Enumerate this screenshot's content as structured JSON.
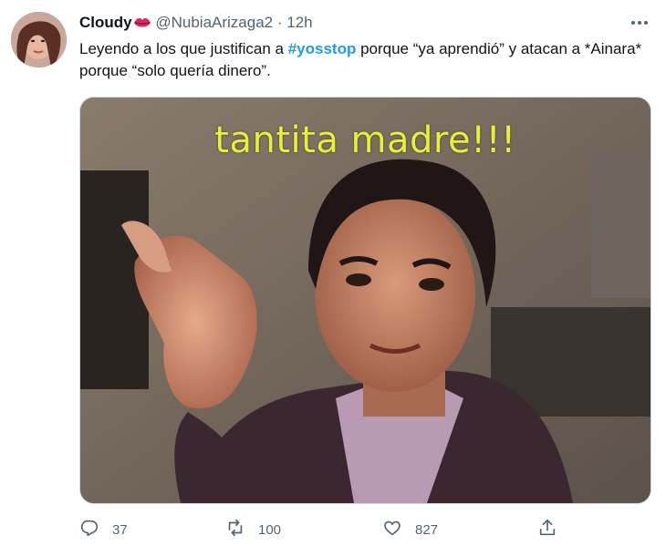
{
  "tweet": {
    "author": {
      "display_name": "Cloudy",
      "handle": "@NubiaArizaga2",
      "separator": "·",
      "time": "12h"
    },
    "text": {
      "part1": "Leyendo a los que justifican a ",
      "hashtag": "#yosstop",
      "part2": " porque “ya aprendió” y atacan a *Ainara* porque “solo quería dinero”."
    },
    "media": {
      "caption": "tantita madre!!!"
    },
    "actions": {
      "replies": "37",
      "retweets": "100",
      "likes": "827"
    }
  },
  "icons": {
    "lips": "kiss-lips-icon",
    "more": "more-dots-icon",
    "reply": "reply-icon",
    "retweet": "retweet-icon",
    "like": "heart-icon",
    "share": "share-icon"
  },
  "colors": {
    "hashtag": "#1d9bf0",
    "secondary_text": "#536471",
    "caption_text": "#e8ee3b"
  }
}
